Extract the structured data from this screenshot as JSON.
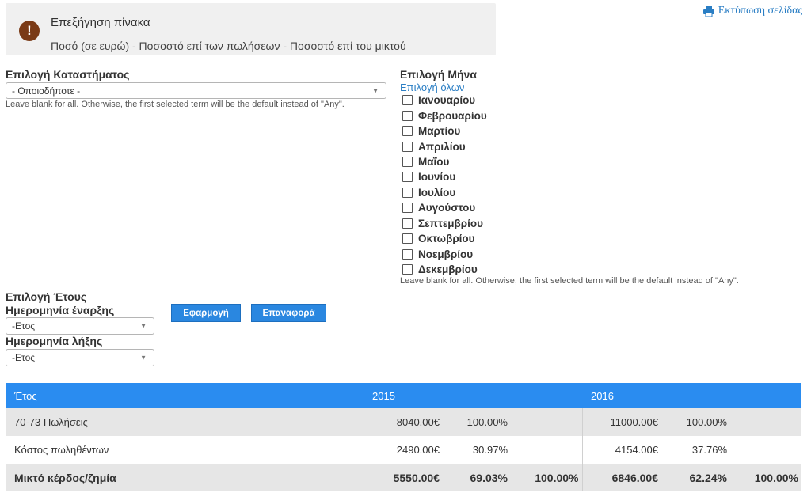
{
  "info": {
    "icon": "exclamation-icon",
    "title": "Επεξήγηση πίνακα",
    "text": "Ποσό (σε ευρώ) - Ποσοστό επί των πωλήσεων - Ποσοστό επί του μικτού"
  },
  "print": {
    "label": "Εκτύπωση σελίδας",
    "icon": "printer-icon"
  },
  "store": {
    "label": "Επιλογή Καταστήματος",
    "selected": "- Οποιοδήποτε -",
    "help": "Leave blank for all. Otherwise, the first selected term will be the default instead of \"Any\"."
  },
  "months": {
    "label": "Επιλογή Μήνα",
    "select_all": "Επιλογή όλων",
    "items": [
      "Ιανουαρίου",
      "Φεβρουαρίου",
      "Μαρτίου",
      "Απριλίου",
      "Μαΐου",
      "Ιουνίου",
      "Ιουλίου",
      "Αυγούστου",
      "Σεπτεμβρίου",
      "Οκτωβρίου",
      "Νοεμβρίου",
      "Δεκεμβρίου"
    ],
    "help": "Leave blank for all. Otherwise, the first selected term will be the default instead of \"Any\"."
  },
  "year": {
    "label": "Επιλογή Έτους",
    "start_label": "Ημερομηνία έναρξης",
    "start_selected": "-Ετος",
    "end_label": "Ημερομηνία λήξης",
    "end_selected": "-Ετος"
  },
  "buttons": {
    "apply": "Εφαρμογή",
    "reset": "Επαναφορά"
  },
  "table": {
    "headers": [
      "Έτος",
      "2015",
      "2016"
    ],
    "rows": [
      {
        "label": "70-73 Πωλήσεις",
        "v2015": [
          "8040.00€",
          "100.00%",
          ""
        ],
        "v2016": [
          "11000.00€",
          "100.00%",
          ""
        ]
      },
      {
        "label": "Κόστος πωληθέντων",
        "v2015": [
          "2490.00€",
          "30.97%",
          ""
        ],
        "v2016": [
          "4154.00€",
          "37.76%",
          ""
        ]
      },
      {
        "label": "Μικτό κέρδος/ζημία",
        "v2015": [
          "5550.00€",
          "69.03%",
          "100.00%"
        ],
        "v2016": [
          "6846.00€",
          "62.24%",
          "100.00%"
        ]
      }
    ]
  },
  "colors": {
    "accent": "#2a8cf0",
    "link": "#2a7ec4",
    "info_icon": "#7a3a16"
  }
}
